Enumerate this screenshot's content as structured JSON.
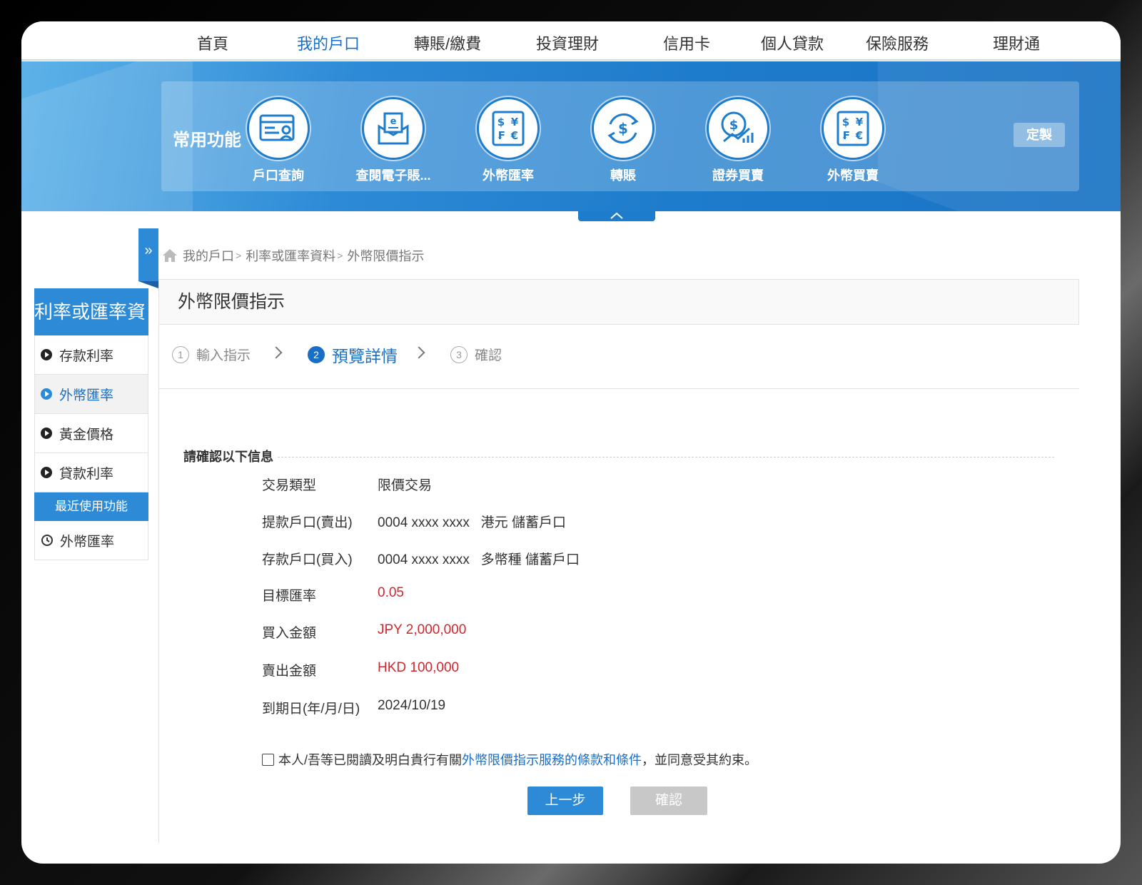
{
  "nav": {
    "items": [
      {
        "label": "首頁"
      },
      {
        "label": "我的戶口"
      },
      {
        "label": "轉賬/繳費"
      },
      {
        "label": "投資理財"
      },
      {
        "label": "信用卡"
      },
      {
        "label": "個人貸款"
      },
      {
        "label": "保險服務"
      },
      {
        "label": "理財通"
      }
    ],
    "active": "我的戶口"
  },
  "quick": {
    "title": "常用功能",
    "items": [
      {
        "label": "戶口查詢",
        "icon": "account-card-icon"
      },
      {
        "label": "查閱電子賬...",
        "icon": "e-statement-icon"
      },
      {
        "label": "外幣匯率",
        "icon": "currency-exchange-icon"
      },
      {
        "label": "轉賬",
        "icon": "transfer-icon"
      },
      {
        "label": "證券買賣",
        "icon": "securities-icon"
      },
      {
        "label": "外幣買賣",
        "icon": "currency-trade-icon"
      }
    ],
    "customize_label": "定製"
  },
  "breadcrumb": {
    "items": [
      "我的戶口",
      "利率或匯率資料",
      "外幣限價指示"
    ],
    "separator": ">"
  },
  "sidebar": {
    "title": "利率或匯率資",
    "items": [
      {
        "label": "存款利率"
      },
      {
        "label": "外幣匯率"
      },
      {
        "label": "黃金價格"
      },
      {
        "label": "貸款利率"
      }
    ],
    "active": "外幣匯率",
    "recent_title": "最近使用功能",
    "recent_items": [
      {
        "label": "外幣匯率"
      }
    ]
  },
  "main": {
    "title": "外幣限價指示",
    "steps": [
      {
        "num": "1",
        "label": "輸入指示"
      },
      {
        "num": "2",
        "label": "預覽詳情"
      },
      {
        "num": "3",
        "label": "確認"
      }
    ],
    "active_step": 2,
    "confirm_heading": "請確認以下信息",
    "details": [
      {
        "label": "交易類型",
        "value": "限價交易",
        "highlight": false
      },
      {
        "label": "提款戶口(賣出)",
        "value": "0004 xxxx xxxx   港元 儲蓄戶口",
        "highlight": false
      },
      {
        "label": "存款戶口(買入)",
        "value": "0004 xxxx xxxx   多幣種 儲蓄戶口",
        "highlight": false
      },
      {
        "label": "目標匯率",
        "value": "0.05",
        "highlight": true
      },
      {
        "label": "買入金額",
        "value": "JPY 2,000,000",
        "highlight": true
      },
      {
        "label": "賣出金額",
        "value": "HKD 100,000",
        "highlight": true
      },
      {
        "label": "到期日(年/月/日)",
        "value": "2024/10/19",
        "highlight": false
      }
    ],
    "agreement": {
      "prefix": "本人/吾等已閱讀及明白貴行有關",
      "link": "外幣限價指示服務的條款和條件",
      "suffix": "，並同意受其約束。",
      "checked": false
    },
    "prev_label": "上一步",
    "confirm_label": "確認"
  },
  "colors": {
    "brand_blue": "#2d8ad6",
    "link_blue": "#1a6fc4",
    "highlight_red": "#d0262d",
    "disabled_grey": "#c8c8c8"
  }
}
